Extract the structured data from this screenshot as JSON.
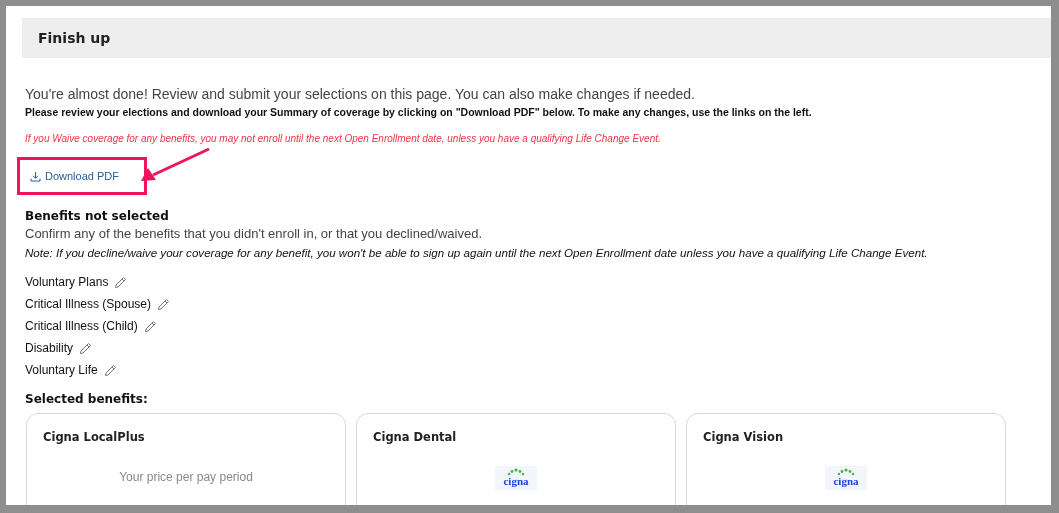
{
  "header": {
    "title": "Finish up"
  },
  "intro": "You're almost done! Review and submit your selections on this page. You can also make changes if needed.",
  "instructions": "Please review your elections and download your Summary of coverage by clicking on \"Download PDF\" below. To make any changes, use the links on the left.",
  "warning": "If you Waive coverage for any benefits, you may not enroll until the next Open Enrollment date, unless you have a qualifying Life Change Event.",
  "download_button": {
    "label": "Download PDF"
  },
  "not_selected": {
    "title": "Benefits not selected",
    "description": "Confirm any of the benefits that you didn't enroll in, or that you declined/waived.",
    "note": "Note: If you decline/waive your coverage for any benefit, you won't be able to sign up again until the next Open Enrollment date unless you have a qualifying Life Change Event.",
    "items": [
      {
        "label": "Voluntary Plans"
      },
      {
        "label": "Critical Illness (Spouse)"
      },
      {
        "label": "Critical Illness (Child)"
      },
      {
        "label": "Disability"
      },
      {
        "label": "Voluntary Life"
      }
    ]
  },
  "selected": {
    "title": "Selected benefits:",
    "cards": [
      {
        "title": "Cigna LocalPlus",
        "kind": "price",
        "price_label": "Your price per pay period"
      },
      {
        "title": "Cigna Dental",
        "kind": "logo",
        "logo": "cigna"
      },
      {
        "title": "Cigna Vision",
        "kind": "logo",
        "logo": "cigna"
      }
    ]
  }
}
